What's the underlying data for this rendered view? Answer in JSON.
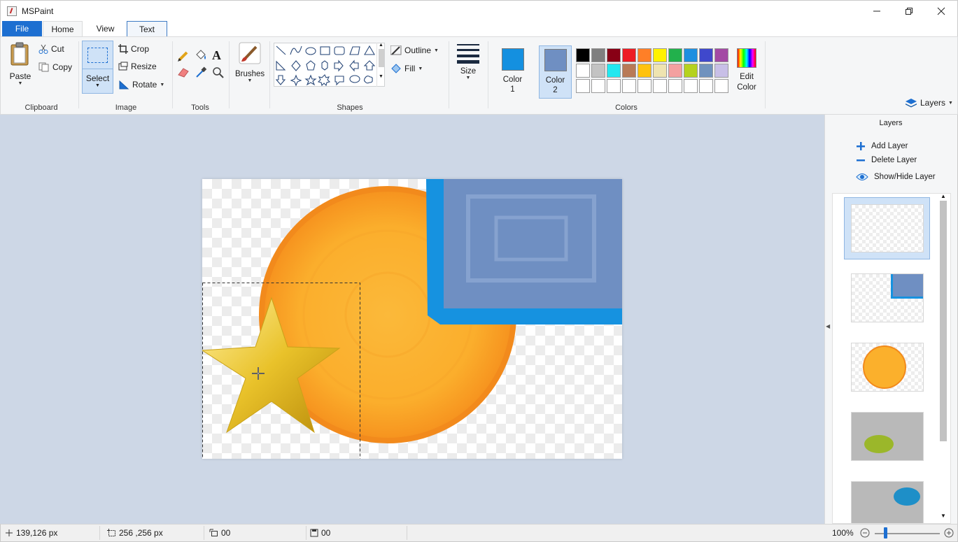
{
  "window": {
    "title": "MSPaint"
  },
  "menu": {
    "tabs": [
      "File",
      "Home",
      "View",
      "Text"
    ]
  },
  "ribbon": {
    "clipboard": {
      "paste": "Paste",
      "cut": "Cut",
      "copy": "Copy",
      "group": "Clipboard"
    },
    "image": {
      "select": "Select",
      "crop": "Crop",
      "resize": "Resize",
      "rotate": "Rotate",
      "group": "Image"
    },
    "tools": {
      "group": "Tools"
    },
    "brushes": {
      "label": "Brushes"
    },
    "shapes": {
      "outline": "Outline",
      "fill": "Fill",
      "group": "Shapes"
    },
    "size": {
      "label": "Size"
    },
    "colors": {
      "color1_label": "Color",
      "color1_num": "1",
      "color2_label": "Color",
      "color2_num": "2",
      "color1": "#1490e0",
      "color2": "#6f8fc2",
      "edit_label": "Edit",
      "edit_label2": "Color",
      "group": "Colors",
      "palette": [
        "#000000",
        "#7f7f7f",
        "#880015",
        "#ed1c24",
        "#ff7f27",
        "#fff200",
        "#22b14c",
        "#1d8fe0",
        "#3f48cc",
        "#a349a4",
        "#ffffff",
        "#c3c3c3",
        "#22e8f0",
        "#b97a57",
        "#ffc20e",
        "#efe4b0",
        "#f4a0a0",
        "#b5d21e",
        "#7092be",
        "#c8bfe7",
        "#ffffff",
        "#ffffff",
        "#ffffff",
        "#ffffff",
        "#ffffff",
        "#ffffff",
        "#ffffff",
        "#ffffff",
        "#ffffff",
        "#ffffff"
      ]
    },
    "layers_dropdown": "Layers"
  },
  "layers_panel": {
    "title": "Layers",
    "add": "Add Layer",
    "delete": "Delete Layer",
    "toggle": "Show/Hide Layer"
  },
  "status": {
    "cursor": "139,126 px",
    "selection": "256 ,256 px",
    "image_size": "00",
    "file_size": "00",
    "zoom": "100%"
  }
}
